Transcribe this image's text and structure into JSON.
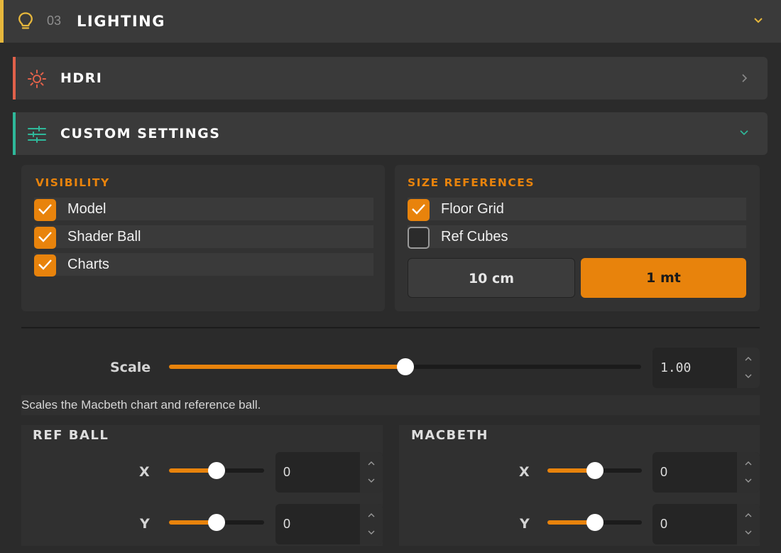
{
  "lighting": {
    "number": "03",
    "title": "LIGHTING",
    "accent_color": "#e6b73c",
    "icon": "lightbulb-icon",
    "expanded": true
  },
  "hdri": {
    "title": "HDRI",
    "accent_color": "#e0614a",
    "icon": "sun-icon",
    "expanded": false
  },
  "custom_settings": {
    "title": "CUSTOM SETTINGS",
    "accent_color": "#2fb89a",
    "icon": "sliders-icon",
    "expanded": true,
    "visibility": {
      "title": "VISIBILITY",
      "items": [
        {
          "label": "Model",
          "checked": true
        },
        {
          "label": "Shader Ball",
          "checked": true
        },
        {
          "label": "Charts",
          "checked": true
        }
      ]
    },
    "size_references": {
      "title": "SIZE REFERENCES",
      "items": [
        {
          "label": "Floor Grid",
          "checked": true
        },
        {
          "label": "Ref Cubes",
          "checked": false
        }
      ],
      "unit_options": [
        "10 cm",
        "1 mt"
      ],
      "selected_unit": "1 mt"
    },
    "scale": {
      "label": "Scale",
      "value": "1.00",
      "fraction": 0.5,
      "hint": "Scales the Macbeth chart and reference ball."
    },
    "ref_ball": {
      "title": "REF BALL",
      "x": {
        "label": "X",
        "value": "0",
        "fraction": 0.5
      },
      "y": {
        "label": "Y",
        "value": "0",
        "fraction": 0.5
      }
    },
    "macbeth": {
      "title": "MACBETH",
      "x": {
        "label": "X",
        "value": "0",
        "fraction": 0.5
      },
      "y": {
        "label": "Y",
        "value": "0",
        "fraction": 0.5
      }
    }
  },
  "theme": {
    "accent": "#e8830c",
    "background": "#2b2b2b"
  }
}
